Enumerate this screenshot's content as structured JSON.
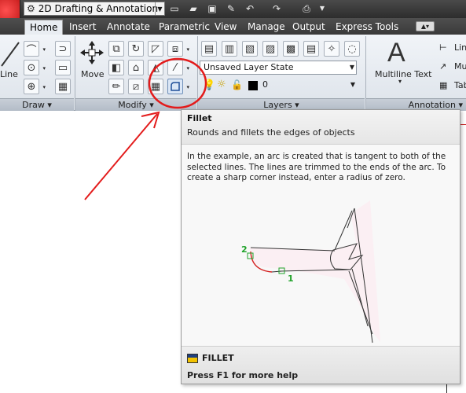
{
  "quick_access": {
    "workspace": "2D Drafting & Annotation",
    "buttons": [
      {
        "name": "new-icon",
        "glyph": "▭"
      },
      {
        "name": "open-icon",
        "glyph": "▰"
      },
      {
        "name": "save-icon",
        "glyph": "▣"
      },
      {
        "name": "save-as-icon",
        "glyph": "✎"
      },
      {
        "name": "undo-icon",
        "glyph": "↶"
      },
      {
        "name": "redo-icon",
        "glyph": "↷"
      },
      {
        "name": "plot-icon",
        "glyph": "⎙"
      }
    ]
  },
  "tabs": [
    "Home",
    "Insert",
    "Annotate",
    "Parametric",
    "View",
    "Manage",
    "Output",
    "Express Tools"
  ],
  "active_tab": "Home",
  "ribbon": {
    "draw": {
      "line_label": "Line",
      "panel_label": "Draw ▾"
    },
    "modify": {
      "move_label": "Move",
      "panel_label": "Modify ▾"
    },
    "layers": {
      "layer_state": "Unsaved Layer State",
      "layer_name": "0",
      "panel_label": "Layers ▾"
    },
    "annotation": {
      "mtext_label": "Multiline Text",
      "linear_label": "Lin",
      "multileader_label": "Mu",
      "table_label": "Tab",
      "panel_label": "Annotation ▾"
    }
  },
  "tooltip": {
    "title": "Fillet",
    "subtitle": "Rounds and fillets the edges of objects",
    "description": "In the example, an arc is created that is tangent to both of the selected lines. The lines are trimmed to the ends of the arc. To create a sharp corner instead, enter a radius of zero.",
    "command": "FILLET",
    "help": "Press F1 for more help",
    "markers": [
      "1",
      "2"
    ]
  },
  "colors": {
    "annotation_red": "#e31b1b",
    "marker_green": "#21a32b",
    "fillet_arc": "#d42020"
  }
}
